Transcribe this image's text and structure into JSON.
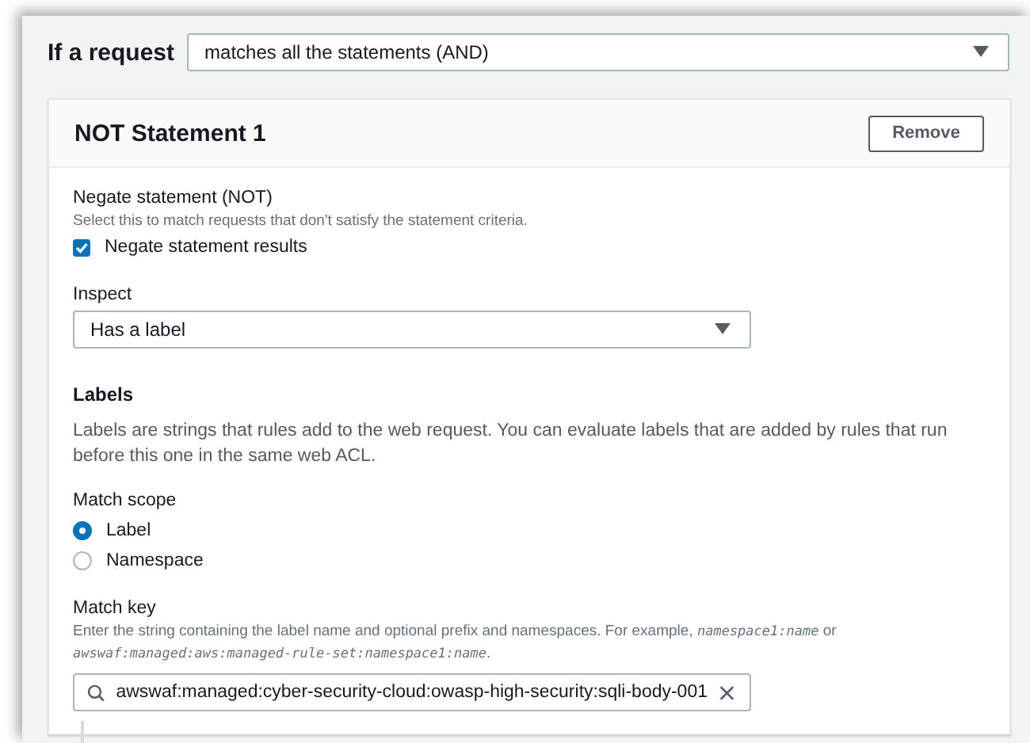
{
  "rule_condition": {
    "label": "If a request",
    "value": "matches all the statements (AND)"
  },
  "statement": {
    "title": "NOT Statement 1",
    "remove_button": "Remove",
    "negate": {
      "label": "Negate statement (NOT)",
      "description": "Select this to match requests that don't satisfy the statement criteria.",
      "checkbox": {
        "label": "Negate statement results",
        "checked": true
      }
    },
    "inspect": {
      "label": "Inspect",
      "value": "Has a label"
    },
    "labels": {
      "heading": "Labels",
      "description": "Labels are strings that rules add to the web request. You can evaluate labels that are added by rules that run before this one in the same web ACL."
    },
    "match_scope": {
      "label": "Match scope",
      "options": [
        {
          "label": "Label",
          "selected": true
        },
        {
          "label": "Namespace",
          "selected": false
        }
      ]
    },
    "match_key": {
      "label": "Match key",
      "description": [
        {
          "kind": "text",
          "text": "Enter the string containing the label name and optional prefix and namespaces. For example, "
        },
        {
          "kind": "code",
          "text": "namespace1:name"
        },
        {
          "kind": "text",
          "text": " or "
        },
        {
          "kind": "code",
          "text": "awswaf:managed:aws:managed-rule-set:namespace1:name"
        },
        {
          "kind": "text",
          "text": "."
        }
      ],
      "value": "awswaf:managed:cyber-security-cloud:owasp-high-security:sqli-body-001"
    }
  }
}
